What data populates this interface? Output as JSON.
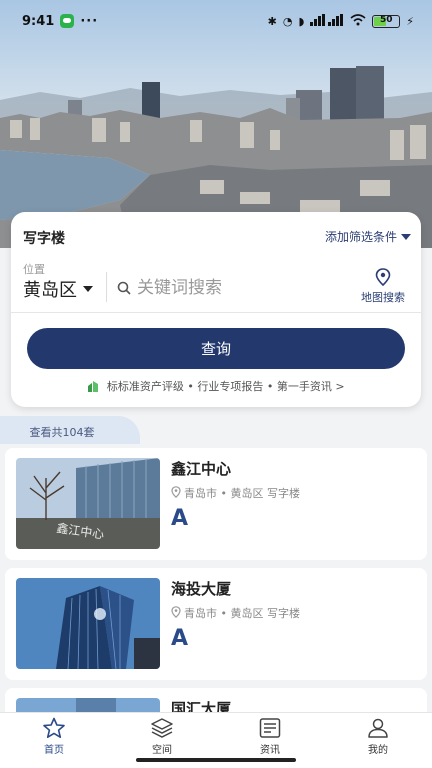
{
  "status_bar": {
    "time": "9:41",
    "more": "···",
    "network_labels": "HD HD",
    "battery_level": "50",
    "icons": [
      "wechat-icon",
      "bluetooth-icon",
      "nfc-icon",
      "silent-icon",
      "signal-icon",
      "wifi-icon",
      "battery-icon",
      "charging-icon"
    ]
  },
  "search": {
    "category": "写字楼",
    "filter_label": "添加筛选条件",
    "location_label": "位置",
    "district": "黄岛区",
    "placeholder": "关键词搜索",
    "map_search_label": "地图搜索",
    "query_button": "查询",
    "promo_text": "标标准资产评级 • 行业专项报告 • 第一手资讯 >"
  },
  "results": {
    "count_label": "查看共104套"
  },
  "listings": [
    {
      "title": "鑫江中心",
      "location": "青岛市 • 黄岛区 写字楼",
      "grade": "A"
    },
    {
      "title": "海投大厦",
      "location": "青岛市 • 黄岛区 写字楼",
      "grade": "A"
    },
    {
      "title": "国汇大厦",
      "location": "",
      "grade": ""
    }
  ],
  "tabs": [
    {
      "label": "首页",
      "icon": "star-icon",
      "active": true
    },
    {
      "label": "空间",
      "icon": "layers-icon",
      "active": false
    },
    {
      "label": "资讯",
      "icon": "news-icon",
      "active": false
    },
    {
      "label": "我的",
      "icon": "user-icon",
      "active": false
    }
  ],
  "colors": {
    "primary": "#23396e",
    "grade": "#2b4a8a",
    "background": "#f2f3f5"
  }
}
